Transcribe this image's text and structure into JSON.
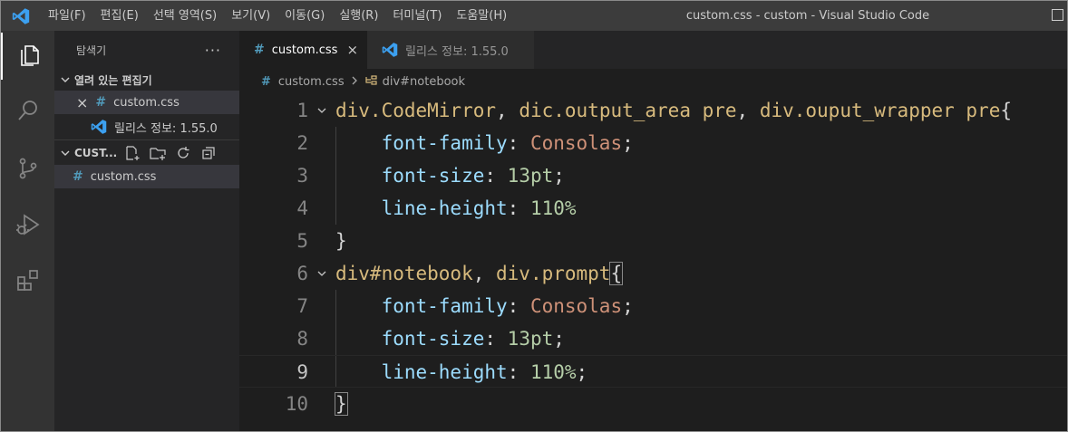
{
  "titlebar": {
    "menu": [
      "파일(F)",
      "편집(E)",
      "선택 영역(S)",
      "보기(V)",
      "이동(G)",
      "실행(R)",
      "터미널(T)",
      "도움말(H)"
    ],
    "window_title": "custom.css - custom - Visual Studio Code"
  },
  "activitybar": {
    "items": [
      "files-icon",
      "search-icon",
      "source-control-icon",
      "run-debug-icon",
      "extensions-icon"
    ]
  },
  "sidebar": {
    "title": "탐색기",
    "more": "···",
    "open_editors": {
      "label": "열려 있는 편집기",
      "items": [
        {
          "label": "custom.css",
          "close": "×"
        },
        {
          "label": "릴리스 정보: 1.55.0"
        }
      ]
    },
    "folder": {
      "label": "CUST...",
      "files": [
        {
          "label": "custom.css"
        }
      ]
    }
  },
  "tabs": [
    {
      "label": "custom.css",
      "close": "×",
      "active": true
    },
    {
      "label": "릴리스 정보: 1.55.0",
      "active": false
    }
  ],
  "breadcrumb": {
    "file": "custom.css",
    "symbol": "div#notebook"
  },
  "editor": {
    "current_line": 9,
    "lines": [
      {
        "n": "1",
        "text": "div.CodeMirror, dic.output_area pre, div.ouput_wrapper pre{"
      },
      {
        "n": "2",
        "text": "    font-family: Consolas;"
      },
      {
        "n": "3",
        "text": "    font-size: 13pt;"
      },
      {
        "n": "4",
        "text": "    line-height: 110%"
      },
      {
        "n": "5",
        "text": "}"
      },
      {
        "n": "6",
        "text": "div#notebook, div.prompt{"
      },
      {
        "n": "7",
        "text": "    font-family: Consolas;"
      },
      {
        "n": "8",
        "text": "    font-size: 13pt;"
      },
      {
        "n": "9",
        "text": "    line-height: 110%;"
      },
      {
        "n": "10",
        "text": "}"
      }
    ]
  },
  "colors": {
    "selector": "#d7ba7d",
    "property": "#9cdcfe",
    "value": "#ce9178",
    "number": "#b5cea8",
    "css_icon": "#519aba",
    "vscode_blue": "#3ca0f0"
  }
}
